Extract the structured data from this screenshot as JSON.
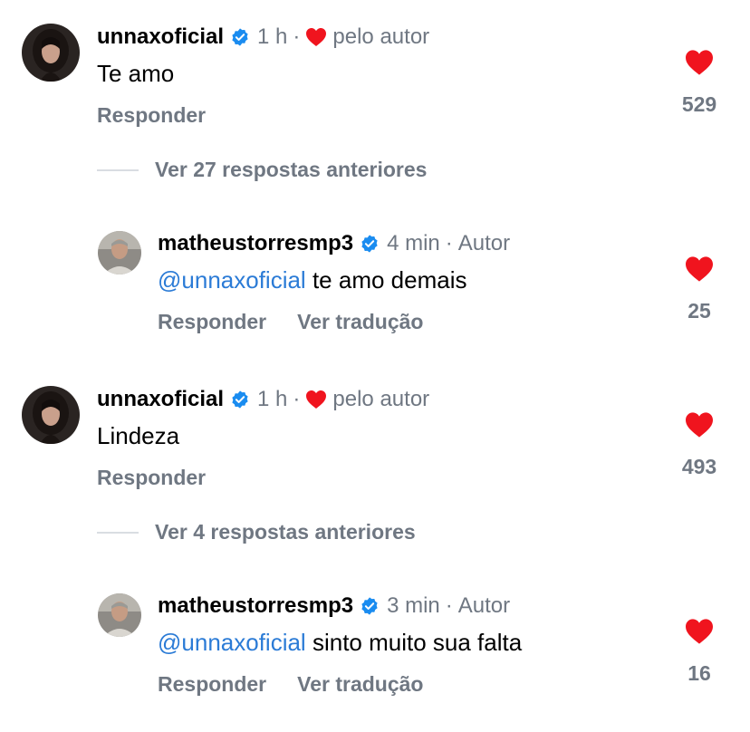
{
  "colors": {
    "muted": "#6f7782",
    "mention": "#2b7bd6",
    "heart": "#f0141e",
    "verified": "#1a8cf0"
  },
  "threads": [
    {
      "comment": {
        "username": "unnaxoficial",
        "verified": true,
        "time": "1 h",
        "dot": "·",
        "liked_by_author_label": "pelo autor",
        "text": "Te amo",
        "reply_label": "Responder",
        "likes": "529"
      },
      "more_replies_label": "Ver 27 respostas anteriores",
      "reply": {
        "username": "matheustorresmp3",
        "verified": true,
        "time": "4 min",
        "dot": "·",
        "author_label": "Autor",
        "mention": "@unnaxoficial",
        "text": "te amo demais",
        "reply_label": "Responder",
        "translate_label": "Ver tradução",
        "likes": "25"
      }
    },
    {
      "comment": {
        "username": "unnaxoficial",
        "verified": true,
        "time": "1 h",
        "dot": "·",
        "liked_by_author_label": "pelo autor",
        "text": "Lindeza",
        "reply_label": "Responder",
        "likes": "493"
      },
      "more_replies_label": "Ver 4 respostas anteriores",
      "reply": {
        "username": "matheustorresmp3",
        "verified": true,
        "time": "3 min",
        "dot": "·",
        "author_label": "Autor",
        "mention": "@unnaxoficial",
        "text": "sinto muito sua falta",
        "reply_label": "Responder",
        "translate_label": "Ver tradução",
        "likes": "16"
      }
    }
  ]
}
